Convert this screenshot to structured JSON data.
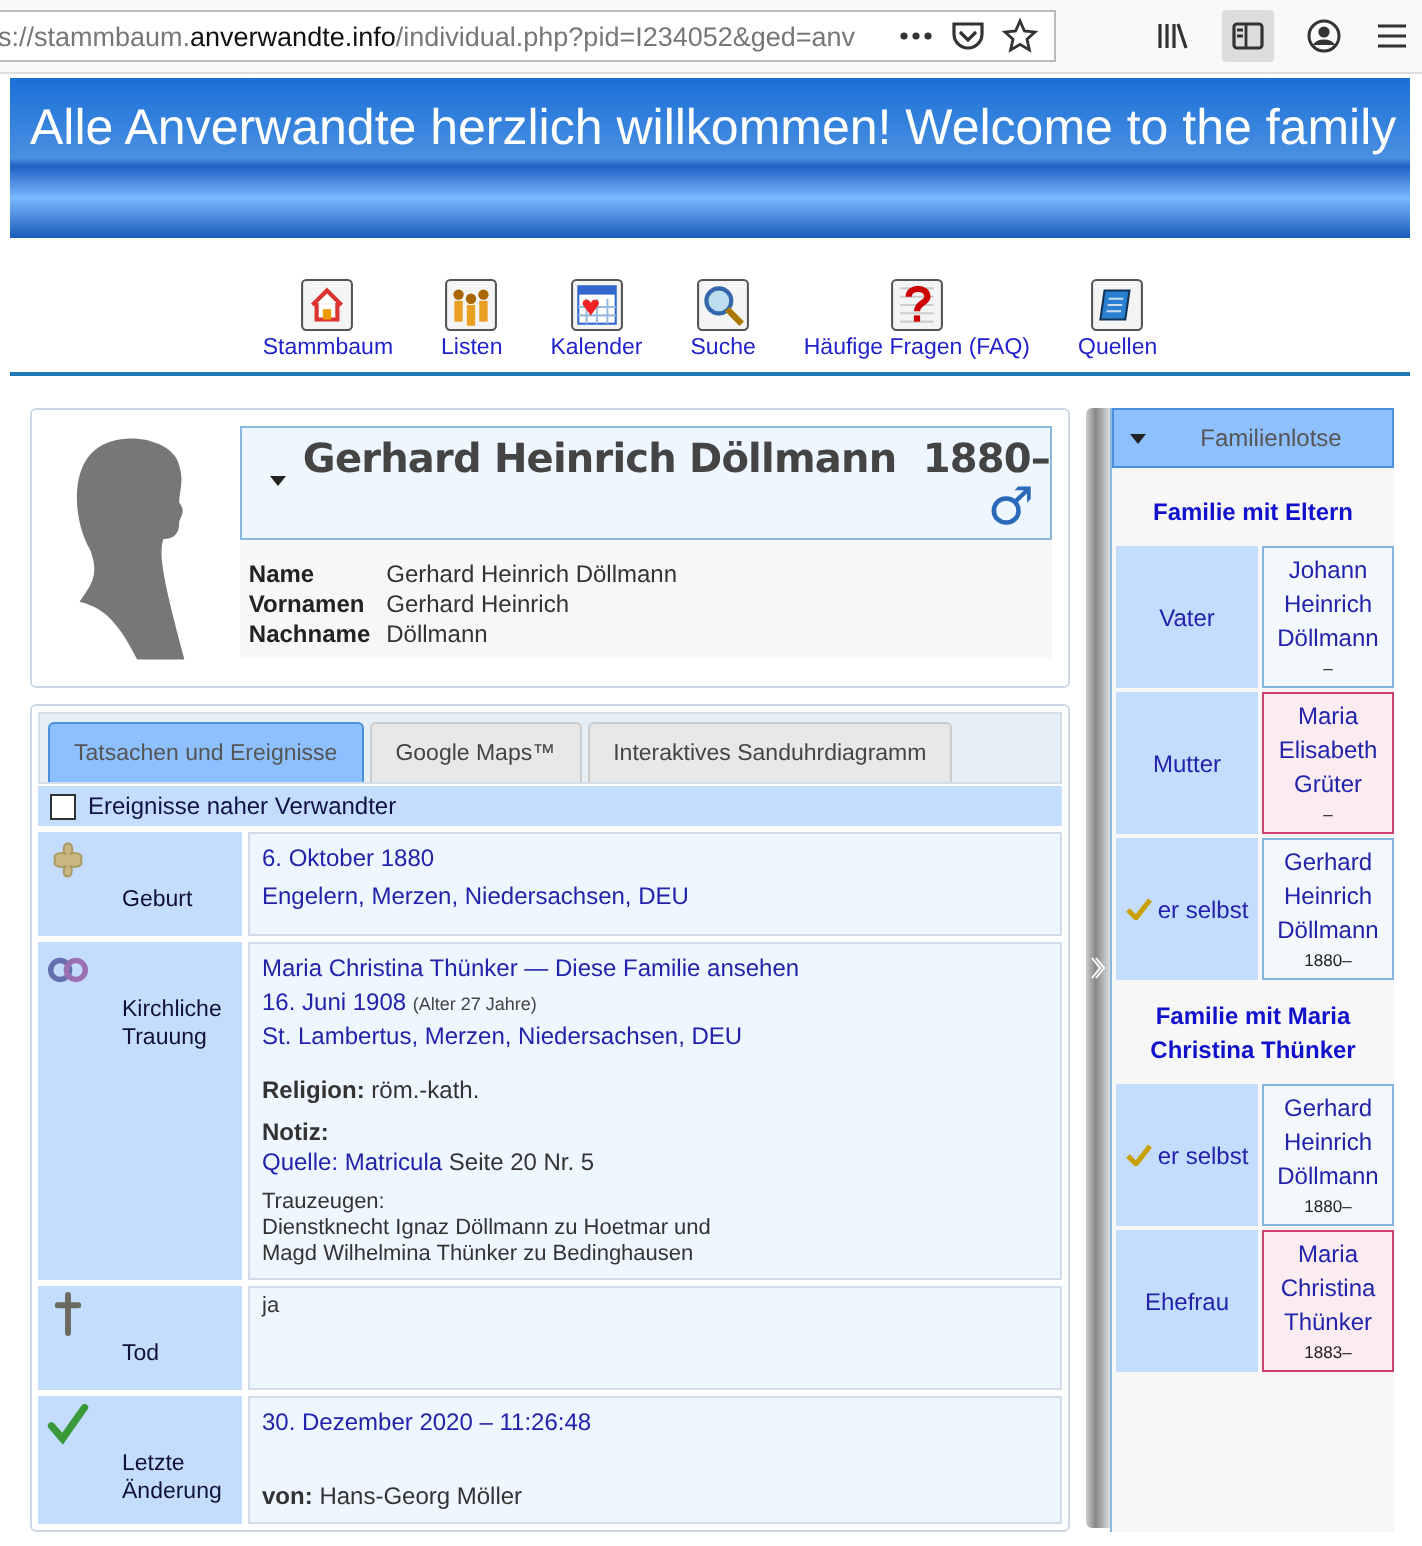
{
  "browser": {
    "url_prefix": "s://stammbaum.",
    "url_host": "anverwandte.info",
    "url_path": "/individual.php?pid=I234052&ged=anv"
  },
  "header": {
    "title": "Alle Anverwandte herzlich willkommen! Welcome to the family"
  },
  "nav": [
    {
      "kind": "home",
      "label": "Stammbaum"
    },
    {
      "kind": "lists",
      "label": "Listen"
    },
    {
      "kind": "calendar",
      "label": "Kalender"
    },
    {
      "kind": "search",
      "label": "Suche"
    },
    {
      "kind": "faq",
      "label": "Häufige Fragen (FAQ)"
    },
    {
      "kind": "sources",
      "label": "Quellen"
    }
  ],
  "person": {
    "title": "Gerhard Heinrich Döllmann",
    "years": "1880–",
    "sex_symbol": "♂",
    "names": [
      {
        "label": "Name",
        "value": "Gerhard Heinrich Döllmann"
      },
      {
        "label": "Vornamen",
        "value": "Gerhard Heinrich"
      },
      {
        "label": "Nachname",
        "value": "Döllmann"
      }
    ]
  },
  "tabs": [
    {
      "label": "Tatsachen und Ereignisse",
      "selected": true
    },
    {
      "label": "Google Maps™",
      "selected": false
    },
    {
      "label": "Interaktives Sanduhrdiagramm",
      "selected": false
    }
  ],
  "relatives_option": {
    "label": "Ereignisse naher Verwandter",
    "checked": false
  },
  "facts": [
    {
      "kind": "birth",
      "label": "Geburt",
      "lines": [
        {
          "kind": "link",
          "text": "6. Oktober 1880"
        },
        {
          "kind": "place",
          "text": "Engelern, Merzen, Niedersachsen, DEU"
        }
      ]
    },
    {
      "kind": "marriage",
      "label": "Kirchliche Trauung",
      "lines": [
        {
          "kind": "link",
          "text": "Maria Christina Thünker — Diese Familie ansehen"
        },
        {
          "kind": "date",
          "text": "16. Juni 1908",
          "note": "(Alter 27 Jahre)"
        },
        {
          "kind": "place",
          "text": "St. Lambertus, Merzen, Niedersachsen, DEU"
        },
        {
          "kind": "field",
          "label": "Religion:",
          "value": "röm.-kath."
        },
        {
          "kind": "heading",
          "text": "Notiz:"
        },
        {
          "kind": "source",
          "link": "Quelle: Matricula",
          "text": "Seite 20 Nr. 5"
        },
        {
          "kind": "note",
          "text": "Trauzeugen:"
        },
        {
          "kind": "text",
          "text": "Dienstknecht Ignaz Döllmann zu Hoetmar und"
        },
        {
          "kind": "text",
          "text": "Magd Wilhelmina Thünker zu Bedinghausen"
        }
      ]
    },
    {
      "kind": "death",
      "label": "Tod",
      "lines": [
        {
          "kind": "text",
          "text": "ja"
        }
      ]
    },
    {
      "kind": "change",
      "label": "Letzte Änderung",
      "lines": [
        {
          "kind": "link",
          "text": "30. Dezember 2020 – 11:26:48"
        },
        {
          "kind": "author",
          "label": "von:",
          "value": "Hans-Georg Möller"
        }
      ]
    }
  ],
  "sidebar": {
    "title": "Familienlotse",
    "families": [
      {
        "title": "Familie mit Eltern",
        "members": [
          {
            "role": "Vater",
            "self": false,
            "color": "#84b4e0",
            "name": "Johann Heinrich Döllmann",
            "years": "–"
          },
          {
            "role": "Mutter",
            "self": false,
            "color": "#d04070",
            "name": "Maria Elisabeth Grüter",
            "years": "–"
          },
          {
            "role": "er selbst",
            "self": true,
            "color": "#84b4e0",
            "name": "Gerhard Heinrich Döllmann",
            "years": "1880–"
          }
        ]
      },
      {
        "title": "Familie mit Maria Christina Thünker",
        "members": [
          {
            "role": "er selbst",
            "self": true,
            "color": "#84b4e0",
            "name": "Gerhard Heinrich Döllmann",
            "years": "1880–"
          },
          {
            "role": "Ehefrau",
            "self": false,
            "color": "#d04070",
            "name": "Maria Christina Thünker",
            "years": "1883–"
          }
        ]
      }
    ]
  }
}
